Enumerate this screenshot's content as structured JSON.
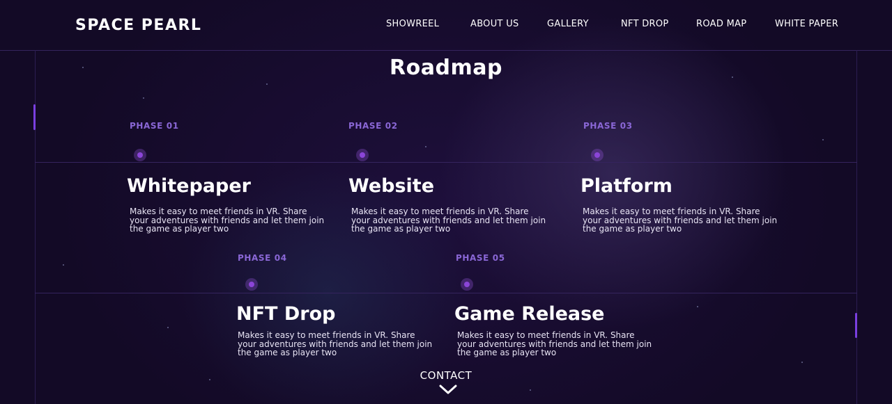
{
  "brand": {
    "logo": "SPACE PEARL"
  },
  "nav": {
    "items": [
      "SHOWREEL",
      "ABOUT US",
      "GALLERY",
      "NFT DROP",
      "ROAD MAP",
      "WHITE PAPER"
    ]
  },
  "roadmap": {
    "title": "Roadmap",
    "phases": [
      {
        "label": "PHASE 01",
        "title": "Whitepaper",
        "description": "Makes it easy to meet friends in VR. Share your adventures with friends and let them join the game as player two"
      },
      {
        "label": "PHASE 02",
        "title": "Website",
        "description": "Makes it easy to meet friends in VR. Share your adventures with friends and let them join the game as player two"
      },
      {
        "label": "PHASE 03",
        "title": "Platform",
        "description": "Makes it easy to meet friends in VR. Share your adventures with friends and let them join the game as player two"
      },
      {
        "label": "PHASE 04",
        "title": "NFT Drop",
        "description": "Makes it easy to meet friends in VR. Share your adventures with friends and let them join the game as player two"
      },
      {
        "label": "PHASE 05",
        "title": "Game Release",
        "description": "Makes it easy to meet friends in VR. Share your adventures with friends and let them join the game as player two"
      }
    ]
  },
  "footer": {
    "contact_label": "CONTACT",
    "contact_icon": "chevron-down-icon"
  },
  "colors": {
    "background": "#130a26",
    "accent": "#8b45d8",
    "phase_label": "#8a67d6"
  }
}
